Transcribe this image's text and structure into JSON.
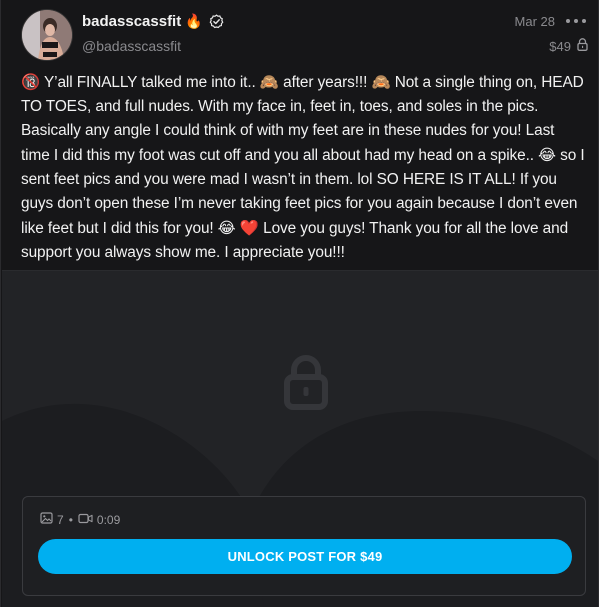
{
  "post": {
    "display_name": "badasscassfit",
    "username": "@badasscassfit",
    "date": "Mar 28",
    "price": "$49",
    "text_segments": [
      {
        "type": "emoji",
        "value": "🔞"
      },
      {
        "type": "text",
        "value": " Y’all FINALLY talked me into it.. "
      },
      {
        "type": "emoji",
        "value": "🙈"
      },
      {
        "type": "text",
        "value": " after years!!! "
      },
      {
        "type": "emoji",
        "value": "🙈"
      },
      {
        "type": "text",
        "value": " Not a single thing on, HEAD TO TOES, and full nudes. With my face in, feet in, toes, and soles in the pics. Basically any angle I could think of with my feet are in these nudes for you! Last time I did this my foot was cut off and you all about had my head on a spike.. "
      },
      {
        "type": "emoji",
        "value": "😂"
      },
      {
        "type": "text",
        "value": " so I sent feet pics and you were mad I wasn’t in them. lol SO HERE IS IT ALL! If you guys don’t open these I’m never taking feet pics for you again be­cause I don’t even like feet but I did this for you! "
      },
      {
        "type": "emoji",
        "value": "😂"
      },
      {
        "type": "text",
        "value": " "
      },
      {
        "type": "emoji",
        "value": "❤️"
      },
      {
        "type": "text",
        "value": " Love you guys! Thank you for all the love and support you always show me. I appreciate you!!!"
      }
    ]
  },
  "media": {
    "photo_count": "7",
    "separator": "•",
    "video_duration": "0:09"
  },
  "unlock": {
    "button_label": "UNLOCK POST FOR $49"
  },
  "colors": {
    "accent": "#00aff0",
    "background": "#161618",
    "locked_bg": "#222326",
    "text": "#f2f2f2",
    "muted": "#8a8a8e"
  },
  "icons": {
    "fire": "🔥",
    "verified": "verified-icon",
    "more": "more-icon",
    "lock": "lock-icon",
    "photo": "image-icon",
    "video": "video-icon"
  }
}
